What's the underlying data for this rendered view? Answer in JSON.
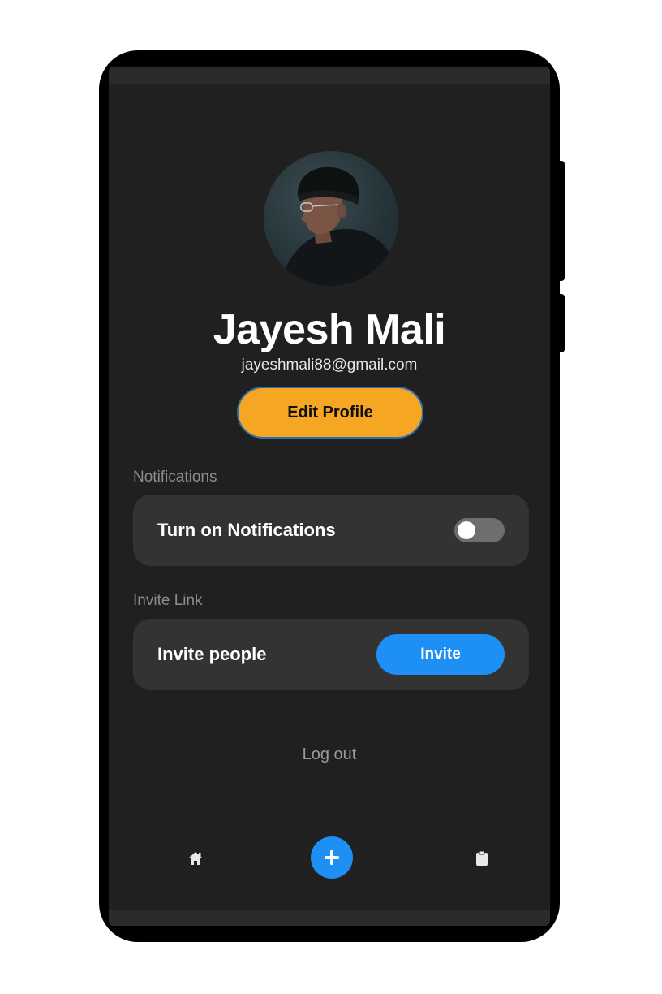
{
  "profile": {
    "name": "Jayesh Mali",
    "email": "jayeshmali88@gmail.com",
    "edit_label": "Edit Profile"
  },
  "notifications": {
    "section_label": "Notifications",
    "row_label": "Turn on Notifications",
    "enabled": false
  },
  "invite": {
    "section_label": "Invite Link",
    "row_label": "Invite people",
    "button_label": "Invite"
  },
  "logout_label": "Log out",
  "bottom_nav": {
    "items": [
      {
        "icon": "home-icon"
      },
      {
        "icon": "plus-icon"
      },
      {
        "icon": "clipboard-icon"
      }
    ]
  },
  "colors": {
    "accent": "#f5a623",
    "primary": "#1e8ff5",
    "background": "#202020",
    "card": "#333333"
  }
}
